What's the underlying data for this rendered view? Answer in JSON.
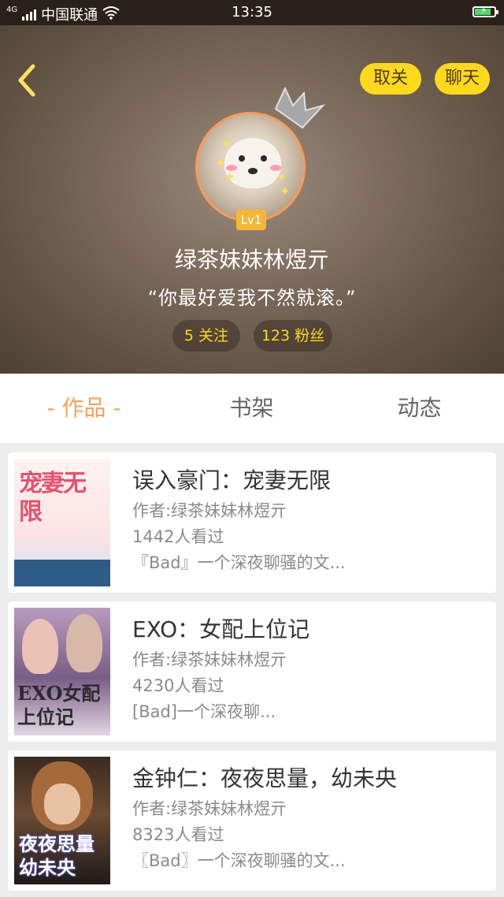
{
  "status_bar": {
    "network": "4G",
    "carrier": "中国联通",
    "time": "13:35"
  },
  "header": {
    "back_icon": "chevron-left-icon",
    "unfollow_label": "取关",
    "chat_label": "聊天",
    "level_badge": "Lv1",
    "nickname": "绿茶妹妹林煜亓",
    "signature": "“你最好爱我不然就滚。”",
    "following_label": "5 关注",
    "followers_label": "123 粉丝"
  },
  "tabs": [
    {
      "label": "- 作品 -",
      "active": true
    },
    {
      "label": "书架",
      "active": false
    },
    {
      "label": "动态",
      "active": false
    }
  ],
  "works": [
    {
      "title": "误入豪门：宠妻无限",
      "author": "作者:绿茶妹妹林煜亓",
      "views": "1442人看过",
      "summary": "『Bad』一个深夜聊骚的文...",
      "cover_text": "宠妻无限"
    },
    {
      "title": "EXO：女配上位记",
      "author": "作者:绿茶妹妹林煜亓",
      "views": "4230人看过",
      "summary": "[Bad]一个深夜聊...",
      "cover_text": "EXO女配上位记"
    },
    {
      "title": "金钟仁：夜夜思量，幼未央",
      "author": "作者:绿茶妹妹林煜亓",
      "views": "8323人看过",
      "summary": "〖Bad〗一个深夜聊骚的文...",
      "cover_text": "夜夜思量幼未央"
    }
  ],
  "colors": {
    "accent_yellow": "#ffd91a",
    "accent_orange": "#f5a25d"
  }
}
